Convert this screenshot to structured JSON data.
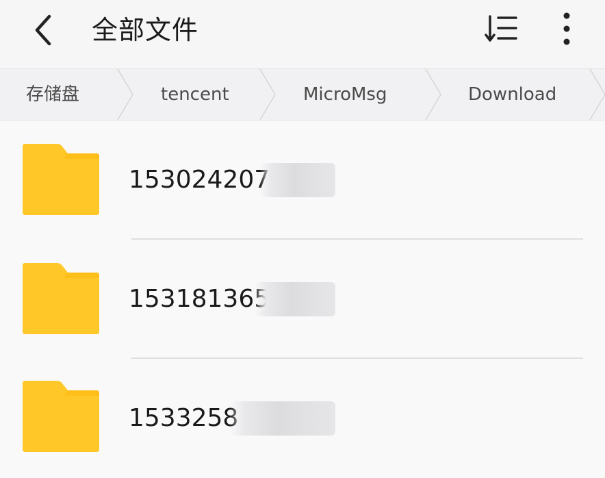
{
  "header": {
    "title": "全部文件",
    "back_icon": "chevron-left-icon",
    "sort_icon": "sort-list-icon",
    "more_icon": "more-vertical-icon"
  },
  "breadcrumb": [
    "存储盘",
    "tencent",
    "MicroMsg",
    "Download"
  ],
  "files": [
    {
      "name": "153024207",
      "icon": "folder-icon",
      "obscured": true
    },
    {
      "name": "153181365",
      "icon": "folder-icon",
      "obscured": true
    },
    {
      "name": "1533258",
      "icon": "folder-icon",
      "obscured": true
    }
  ],
  "colors": {
    "folder": "#ffc727",
    "folder_tab": "#ffbf1a",
    "background": "#f9f9fa",
    "header_bg": "#f6f6f7",
    "breadcrumb_bg": "#f1f1f3"
  }
}
